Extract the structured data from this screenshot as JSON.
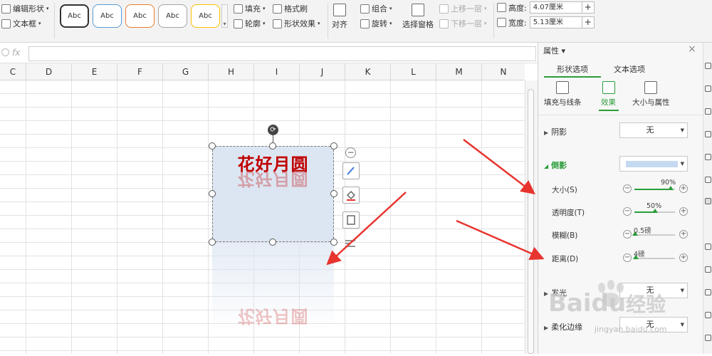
{
  "ribbon": {
    "edit_shape": "编辑形状",
    "text_box": "文本框",
    "style_samples": [
      "Abc",
      "Abc",
      "Abc",
      "Abc",
      "Abc"
    ],
    "style_colors": [
      "#333333",
      "#5b9bd5",
      "#ed7d31",
      "#a5a5a5",
      "#ffc000"
    ],
    "fill": "填充",
    "outline": "轮廓",
    "format_painter": "格式刷",
    "shape_effects": "形状效果",
    "align": "对齐",
    "group": "组合",
    "rotate": "旋转",
    "selection_pane": "选择窗格",
    "bring_forward": "上移一层",
    "send_backward": "下移一层",
    "height_label": "高度:",
    "height_value": "4.07厘米",
    "width_label": "宽度:",
    "width_value": "5.13厘米"
  },
  "formula_bar": {
    "fx": "fx",
    "value": ""
  },
  "columns": [
    "C",
    "D",
    "E",
    "F",
    "G",
    "H",
    "I",
    "J",
    "K",
    "L",
    "M",
    "N"
  ],
  "shape": {
    "title": "花好月圆",
    "fill_color": "#dce6f2",
    "text_color": "#c00000"
  },
  "panel": {
    "title": "属性",
    "tabs": [
      "形状选项",
      "文本选项"
    ],
    "subtabs": [
      "填充与线条",
      "效果",
      "大小与属性"
    ],
    "shadow_label": "阴影",
    "shadow_value": "无",
    "reflection_label": "倒影",
    "reflection_color": "#c5d9f1",
    "size_label": "大小(S)",
    "size_value": "90%",
    "size_fraction": 0.9,
    "transparency_label": "透明度(T)",
    "transparency_value": "50%",
    "transparency_fraction": 0.5,
    "blur_label": "模糊(B)",
    "blur_value": "0.5磅",
    "blur_fraction": 0.02,
    "distance_label": "距离(D)",
    "distance_value": "4磅",
    "distance_fraction": 0.04,
    "glow_label": "发光",
    "glow_value": "无",
    "soft_edges_label": "柔化边缘",
    "soft_edges_value": "无"
  },
  "watermark": {
    "brand": "Baidu",
    "brand_cn": "经验",
    "url": "jingyan.baidu.com"
  },
  "accent": "#2a9d3a",
  "arrow_color": "#e8342e"
}
